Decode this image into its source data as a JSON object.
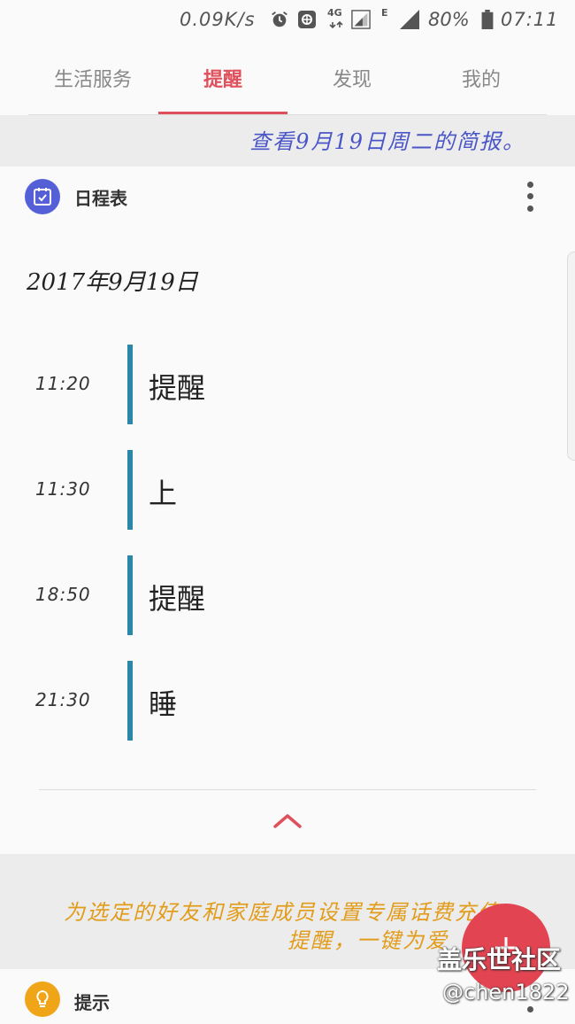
{
  "status_bar": {
    "network_speed": "0.09K/s",
    "network_type": "4G",
    "signal_mode": "E",
    "battery": "80%",
    "time": "07:11"
  },
  "tabs": [
    {
      "label": "生活服务"
    },
    {
      "label": "提醒"
    },
    {
      "label": "发现"
    },
    {
      "label": "我的"
    }
  ],
  "active_tab": "提醒",
  "briefing": {
    "text": "查看9月19日周二的简报。"
  },
  "schedule": {
    "title": "日程表",
    "date": "2017年9月19日",
    "events": [
      {
        "time": "11:20",
        "title": "提醒"
      },
      {
        "time": "11:30",
        "title": "上"
      },
      {
        "time": "18:50",
        "title": "提醒"
      },
      {
        "time": "21:30",
        "title": "睡"
      }
    ]
  },
  "promo": {
    "line1": "为选定的好友和家庭成员设置专属话费充值",
    "line2": "提醒，一键为爱"
  },
  "tips": {
    "label": "提示"
  },
  "watermark": {
    "site": "盖乐世社区",
    "user": "@chen1822"
  },
  "colors": {
    "accent": "#e0505c",
    "event_bar": "#2b87a8",
    "calendar_icon": "#5560d8",
    "tips_icon": "#f0a418",
    "briefing_text": "#4a56c7",
    "promo_text": "#e29c1b"
  }
}
